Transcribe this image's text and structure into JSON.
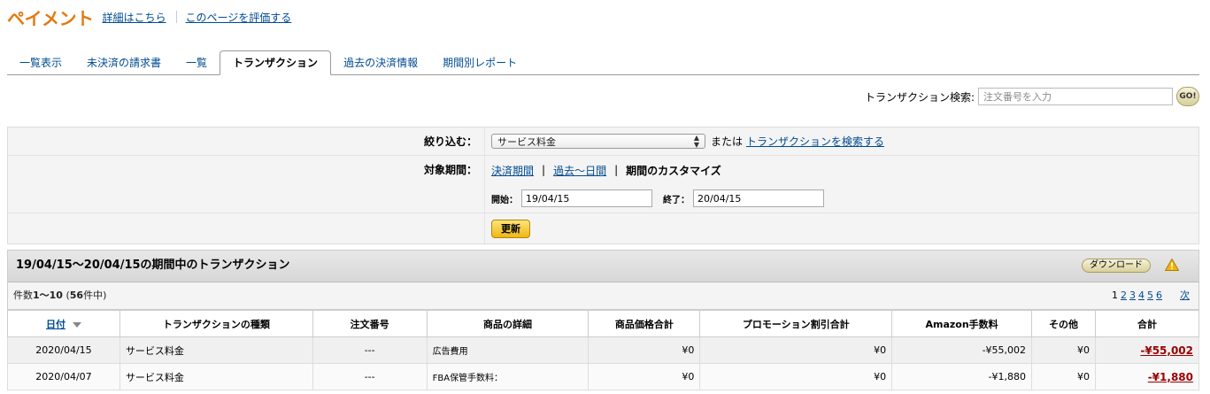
{
  "header": {
    "title": "ペイメント",
    "details_link": "詳細はこちら",
    "rate_link": "このページを評価する"
  },
  "tabs": [
    {
      "label": "一覧表示",
      "active": false
    },
    {
      "label": "未決済の請求書",
      "active": false
    },
    {
      "label": "一覧",
      "active": false
    },
    {
      "label": "トランザクション",
      "active": true
    },
    {
      "label": "過去の決済情報",
      "active": false
    },
    {
      "label": "期間別レポート",
      "active": false
    }
  ],
  "search": {
    "label": "トランザクション検索:",
    "placeholder": "注文番号を入力",
    "go_label": "GO!"
  },
  "filter": {
    "narrow_label": "絞り込む：",
    "selected_type": "サービス料金",
    "or_text": "または",
    "search_link": "トランザクションを検索する",
    "period_label": "対象期間：",
    "period_option_settlement": "決済期間",
    "period_option_past_days": "過去〜日間",
    "period_option_custom": "期間のカスタマイズ",
    "start_label": "開始：",
    "start_value": "19/04/15",
    "end_label": "終了：",
    "end_value": "20/04/15",
    "update_label": "更新"
  },
  "results": {
    "title": "19/04/15〜20/04/15の期間中のトランザクション",
    "download_label": "ダウンロード",
    "count_prefix": "件数",
    "count_range": "1〜10",
    "count_open": " (",
    "count_total": "56",
    "count_suffix": "件中)",
    "pages": [
      "1",
      "2",
      "3",
      "4",
      "5",
      "6"
    ],
    "next_label": "次"
  },
  "table": {
    "columns": [
      "日付",
      "トランザクションの種類",
      "注文番号",
      "商品の詳細",
      "商品価格合計",
      "プロモーション割引合計",
      "Amazon手数料",
      "その他",
      "合計"
    ],
    "rows": [
      {
        "date": "2020/04/15",
        "type": "サービス料金",
        "order": "---",
        "detail": "広告費用",
        "price": "¥0",
        "promo": "¥0",
        "fee": "-¥55,002",
        "other": "¥0",
        "total": "-¥55,002"
      },
      {
        "date": "2020/04/07",
        "type": "サービス料金",
        "order": "---",
        "detail": "FBA保管手数料：",
        "price": "¥0",
        "promo": "¥0",
        "fee": "-¥1,880",
        "other": "¥0",
        "total": "-¥1,880"
      }
    ]
  },
  "colors": {
    "title_orange": "#e47911",
    "link_blue": "#004b91",
    "negative_red": "#990000",
    "button_yellow": "#efb715"
  }
}
